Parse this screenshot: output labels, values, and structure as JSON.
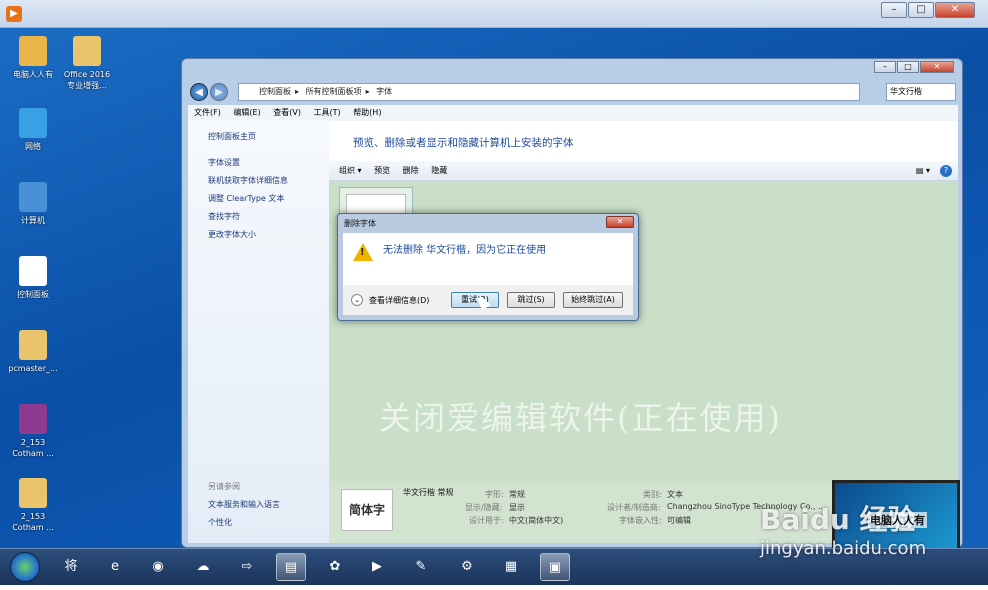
{
  "outer_window": {
    "controls": [
      "–",
      "□",
      "✕"
    ]
  },
  "desktop_icons": [
    {
      "label": "电脑人人有",
      "icon": "folder-icon",
      "color": "#e9b44a"
    },
    {
      "label": "Office 2016 专业增强...",
      "icon": "folder-icon",
      "color": "#e9c46a"
    },
    {
      "label": "网络",
      "icon": "network-icon",
      "color": "#3aa0e6"
    },
    {
      "label": "计算机",
      "icon": "computer-icon",
      "color": "#4a90d9"
    },
    {
      "label": "控制面板",
      "icon": "panda-icon",
      "color": "#ffffff"
    },
    {
      "label": "pcmaster_...",
      "icon": "file-icon",
      "color": "#e9c46a"
    },
    {
      "label": "2_153 Cotham ...",
      "icon": "archive-icon",
      "color": "#8e3a8e"
    },
    {
      "label": "2_153 Cotham ...",
      "icon": "file-icon",
      "color": "#e9c46a"
    }
  ],
  "explorer": {
    "controls": [
      "–",
      "□",
      "✕"
    ],
    "breadcrumb": [
      "控制面板",
      "所有控制面板项",
      "字体"
    ],
    "search_value": "华文行楷",
    "menu": [
      "文件(F)",
      "编辑(E)",
      "查看(V)",
      "工具(T)",
      "帮助(H)"
    ],
    "side_links": [
      "控制面板主页",
      "字体设置",
      "联机获取字体详细信息",
      "调整 ClearType 文本",
      "查找字符",
      "更改字体大小"
    ],
    "see_also_title": "另请参阅",
    "see_also_links": [
      "文本服务和输入语言",
      "个性化"
    ],
    "header_title": "预览、删除或者显示和隐藏计算机上安装的字体",
    "toolbar": [
      "组织 ▾",
      "预览",
      "删除",
      "隐藏"
    ],
    "font_tile_preview": "简体字",
    "details": {
      "thumb_text": "简体字",
      "name": "华文行楷 常规",
      "style_label": "字形:",
      "style_value": "常规",
      "show_label": "显示/隐藏:",
      "show_value": "显示",
      "design_label": "设计用于:",
      "design_value": "中文(简体中文)",
      "category_label": "类别:",
      "category_value": "文本",
      "designer_label": "设计者/制造商:",
      "designer_value": "Changzhou SinoType Technology Co., ...",
      "embed_label": "字体嵌入性:",
      "embed_value": "可编辑"
    }
  },
  "overlay_caption": "关闭爱编辑软件(正在使用)",
  "dialog": {
    "title": "删除字体",
    "message": "无法删除 华文行楷，因为它正在使用",
    "details_link": "查看详细信息(D)",
    "btn_retry": "重试(R)",
    "btn_skip": "跳过(S)",
    "btn_skip_all": "始终跳过(A)",
    "close": "✕"
  },
  "taskbar_icons": [
    "将",
    "e",
    "◉",
    "☁",
    "⇨",
    "▤",
    "✿",
    "▶",
    "✎",
    "⚙",
    "▦",
    "▣"
  ],
  "watermark": {
    "brand": "Baidu 经验",
    "url": "jingyan.baidu.com",
    "laptop_text": "电脑人人有"
  }
}
